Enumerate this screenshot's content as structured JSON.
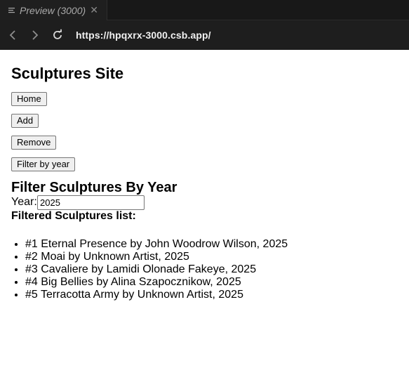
{
  "browser": {
    "tab_title": "Preview (3000)",
    "url": "https://hpqxrx-3000.csb.app/"
  },
  "page": {
    "title": "Sculptures Site",
    "buttons": {
      "home": "Home",
      "add": "Add",
      "remove": "Remove",
      "filter": "Filter by year"
    },
    "filter_heading": "Filter Sculptures By Year",
    "year_label": "Year:",
    "year_value": "2025",
    "list_heading": "Filtered Sculptures list:",
    "results": [
      "#1 Eternal Presence by John Woodrow Wilson, 2025",
      "#2 Moai by Unknown Artist, 2025",
      "#3 Cavaliere by Lamidi Olonade Fakeye, 2025",
      "#4 Big Bellies by Alina Szapocznikow, 2025",
      "#5 Terracotta Army by Unknown Artist, 2025"
    ]
  }
}
